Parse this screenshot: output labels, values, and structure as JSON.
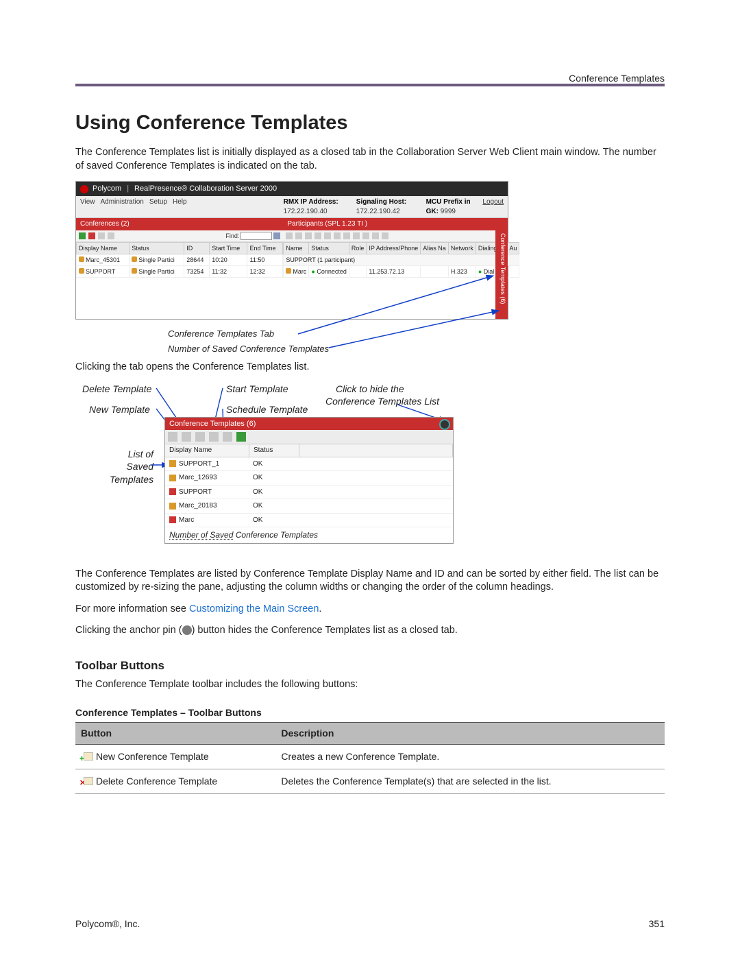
{
  "header_right": "Conference Templates",
  "title": "Using Conference Templates",
  "intro": "The Conference Templates list is initially displayed as a closed tab in the Collaboration Server Web Client main window. The number of saved Conference Templates is indicated on the tab.",
  "fig1": {
    "window_brand": "Polycom",
    "window_title": "RealPresence® Collaboration Server 2000",
    "menu": {
      "items": [
        "View",
        "Administration",
        "Setup",
        "Help"
      ]
    },
    "statusbar": {
      "rmx_ip_label": "RMX IP Address:",
      "rmx_ip": "172.22.190.40",
      "signal_label": "Signaling Host:",
      "signal": "172.22.190.42",
      "mcu_label": "MCU Prefix in GK:",
      "mcu": "9999",
      "logout": "Logout"
    },
    "conf_tab": "Conferences (2)",
    "part_tab": "Participants (SPL 1.23 TI )",
    "find_label": "Find:",
    "conf_cols": [
      "Display Name",
      "Status",
      "ID",
      "Start Time",
      "End Time"
    ],
    "conf_rows": [
      {
        "name": "Marc_45301",
        "status": "Single Partici",
        "id": "28644",
        "start": "10:20",
        "end": "11:50"
      },
      {
        "name": "SUPPORT",
        "status": "Single Partici",
        "id": "73254",
        "start": "11:32",
        "end": "12:32"
      }
    ],
    "part_cols": [
      "Name",
      "Status",
      "Role",
      "IP Address/Phone",
      "Alias Na",
      "Network",
      "Dialing Di",
      "Au"
    ],
    "part_sub": "SUPPORT (1 participant)",
    "part_rows": [
      {
        "name": "Marc",
        "status": "Connected",
        "ip": "11.253.72.13",
        "net": "H.323",
        "dial": "Dial o"
      }
    ],
    "vtab": "Conference Templates (6)",
    "annot": {
      "tab": "Conference Templates Tab",
      "count": "Number of Saved Conference Templates"
    }
  },
  "after_fig1": "Clicking the tab opens the Conference Templates list.",
  "fig2": {
    "labels": {
      "delete": "Delete Template",
      "new": "New Template",
      "start": "Start Template",
      "schedule": "Schedule Template",
      "hide": "Click to hide the",
      "hide2": "Conference Templates List",
      "listof": "List of\nSaved\nTemplates",
      "footer_line": "Number of Saved Conference Templates",
      "footer_pref": "Number of Saved"
    },
    "panel_title": "Conference Templates (6)",
    "cols": [
      "Display Name",
      "Status"
    ],
    "rows": [
      {
        "name": "SUPPORT_1",
        "status": "OK",
        "multi": false
      },
      {
        "name": "Marc_12693",
        "status": "OK",
        "multi": false
      },
      {
        "name": "SUPPORT",
        "status": "OK",
        "multi": true
      },
      {
        "name": "Marc_20183",
        "status": "OK",
        "multi": false
      },
      {
        "name": "Marc",
        "status": "OK",
        "multi": true
      }
    ]
  },
  "para_sort": "The Conference Templates are listed by Conference Template Display Name and ID and can be sorted by either field. The list can be customized by re-sizing the pane, adjusting the column widths or changing the order of the column headings.",
  "para_more_pre": "For more information see ",
  "para_more_link": "Customizing the Main Screen",
  "para_more_post": ".",
  "para_pin_pre": "Clicking the anchor pin (",
  "para_pin_post": ") button hides the Conference Templates list as a closed tab.",
  "sub_heading": "Toolbar Buttons",
  "sub_intro": "The Conference Template toolbar includes the following buttons:",
  "table_title": "Conference Templates – Toolbar Buttons",
  "table_cols": [
    "Button",
    "Description"
  ],
  "table_rows": [
    {
      "btn": "New Conference Template",
      "desc": "Creates a new Conference Template.",
      "icon": "new"
    },
    {
      "btn": "Delete Conference Template",
      "desc": "Deletes the Conference Template(s) that are selected in the list.",
      "icon": "del"
    }
  ],
  "footer": {
    "left": "Polycom®, Inc.",
    "page": "351"
  }
}
